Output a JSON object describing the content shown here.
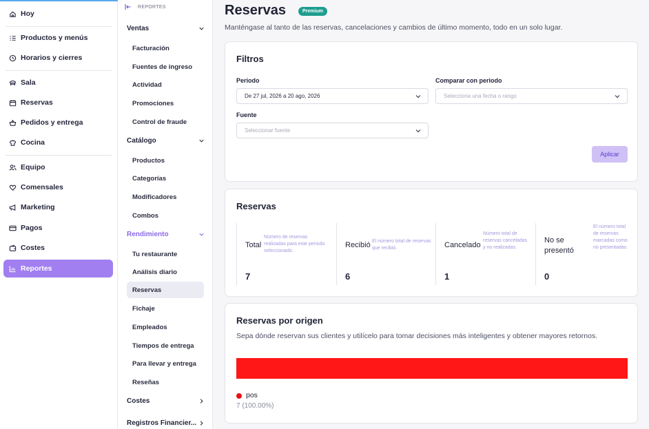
{
  "nav": {
    "items": [
      {
        "label": "Hoy",
        "icon": "home-icon"
      },
      {
        "label": "Productos y menús",
        "icon": "list-icon"
      },
      {
        "label": "Horarios y cierres",
        "icon": "clock-icon"
      },
      {
        "label": "Sala",
        "icon": "table-icon"
      },
      {
        "label": "Reservas",
        "icon": "calendar-icon"
      },
      {
        "label": "Pedidos y entrega",
        "icon": "basket-icon"
      },
      {
        "label": "Cocina",
        "icon": "chef-hat-icon"
      },
      {
        "label": "Equipo",
        "icon": "users-icon"
      },
      {
        "label": "Comensales",
        "icon": "heart-icon"
      },
      {
        "label": "Marketing",
        "icon": "megaphone-icon"
      },
      {
        "label": "Pagos",
        "icon": "card-icon"
      },
      {
        "label": "Costes",
        "icon": "wallet-icon"
      },
      {
        "label": "Reportes",
        "icon": "chart-icon"
      }
    ],
    "active": "Reportes"
  },
  "subnav": {
    "header": "REPORTES",
    "sections": {
      "ventas": "Ventas",
      "catalogo": "Catálogo",
      "rendimiento": "Rendimiento",
      "costes": "Costes",
      "registros": "Registros Financier..."
    },
    "ventas_items": [
      "Facturación",
      "Fuentes de ingreso",
      "Actividad",
      "Promociones",
      "Control de fraude"
    ],
    "catalogo_items": [
      "Productos",
      "Categorías",
      "Modificadores",
      "Combos"
    ],
    "rendimiento_items": [
      "Tu restaurante",
      "Análisis diario",
      "Reservas",
      "Fichaje",
      "Empleados",
      "Tiempos de entrega",
      "Para llevar y entrega",
      "Reseñas"
    ],
    "active": "Reservas"
  },
  "page": {
    "title": "Reservas",
    "badge": "Premium",
    "subtitle": "Manténgase al tanto de las reservas, cancelaciones y cambios de último momento, todo en un solo lugar."
  },
  "filters": {
    "title": "Filtros",
    "period_label": "Periodo",
    "period_value": "De 27 jul, 2026 a 20 ago, 2026",
    "compare_label": "Comparar con periodo",
    "compare_placeholder": "Selecciona una fecha o rango",
    "source_label": "Fuente",
    "source_placeholder": "Seleccionar fuente",
    "apply_label": "Aplicar"
  },
  "reservas": {
    "title": "Reservas",
    "stats": [
      {
        "label": "Total",
        "description": "Número de reservas realizadas para este periodo seleccionado.",
        "value": "7"
      },
      {
        "label": "Recibió",
        "description": "El número total de reservas que recibió.",
        "value": "6"
      },
      {
        "label": "Cancelado",
        "description": "Número total de reservas canceladas y no realizadas.",
        "value": "1"
      },
      {
        "label": "No se presentó",
        "description": "El número total de reservas marcadas como no presentadas.",
        "value": "0"
      }
    ]
  },
  "origin": {
    "title": "Reservas por origen",
    "subtitle": "Sepa dónde reservan sus clientes y utilícelo para tomar decisiones más inteligentes y obtener mayores retornos.",
    "segments": [
      {
        "name": "pos",
        "share": 1.0,
        "label": "7 (100.00%)",
        "color": "#ff1616"
      }
    ]
  }
}
